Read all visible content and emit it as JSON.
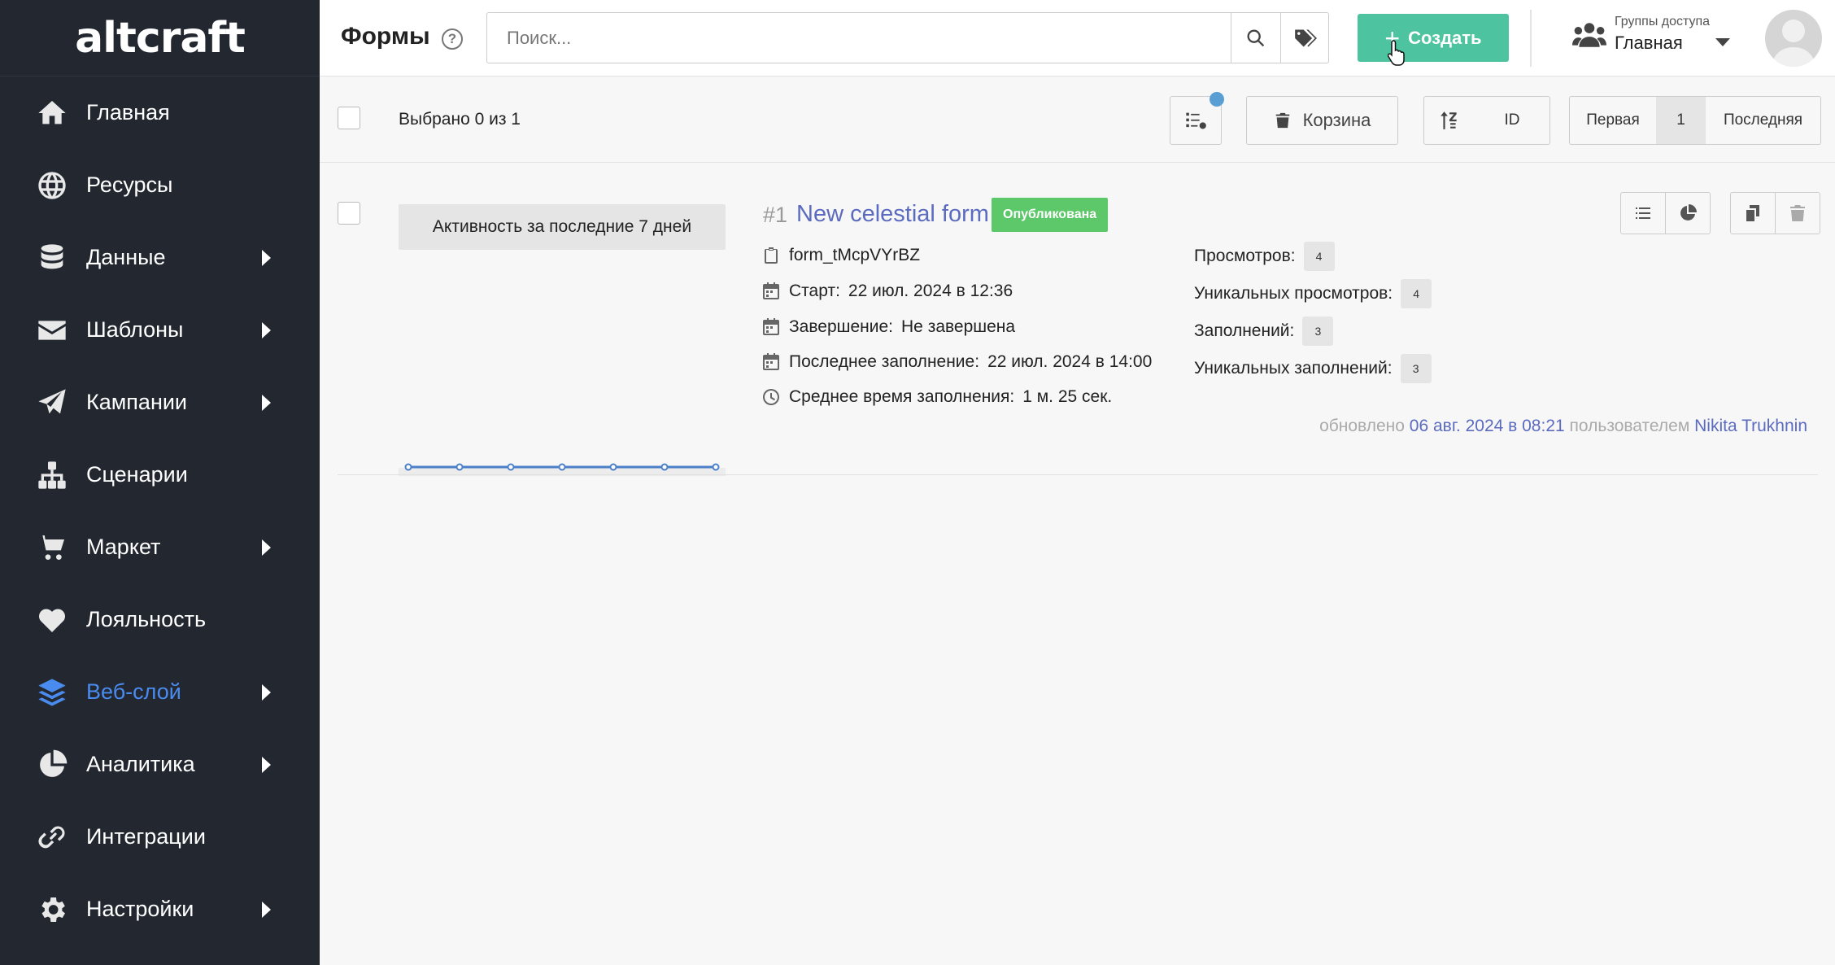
{
  "app": {
    "logo_text": "altcraft"
  },
  "sidebar": {
    "items": [
      {
        "label": "Главная",
        "icon": "home-icon",
        "has_submenu": false,
        "active": false
      },
      {
        "label": "Ресурсы",
        "icon": "globe-icon",
        "has_submenu": false,
        "active": false
      },
      {
        "label": "Данные",
        "icon": "database-icon",
        "has_submenu": true,
        "active": false
      },
      {
        "label": "Шаблоны",
        "icon": "envelope-icon",
        "has_submenu": true,
        "active": false
      },
      {
        "label": "Кампании",
        "icon": "paper-plane-icon",
        "has_submenu": true,
        "active": false
      },
      {
        "label": "Сценарии",
        "icon": "sitemap-icon",
        "has_submenu": false,
        "active": false
      },
      {
        "label": "Маркет",
        "icon": "cart-icon",
        "has_submenu": true,
        "active": false
      },
      {
        "label": "Лояльность",
        "icon": "heart-icon",
        "has_submenu": false,
        "active": false
      },
      {
        "label": "Веб-слой",
        "icon": "layers-icon",
        "has_submenu": true,
        "active": true
      },
      {
        "label": "Аналитика",
        "icon": "pie-chart-icon",
        "has_submenu": true,
        "active": false
      },
      {
        "label": "Интеграции",
        "icon": "link-icon",
        "has_submenu": false,
        "active": false
      },
      {
        "label": "Настройки",
        "icon": "gear-icon",
        "has_submenu": true,
        "active": false
      }
    ],
    "active_color": "#4a8bf0",
    "background": "#232830"
  },
  "header": {
    "title": "Формы",
    "help_symbol": "?",
    "search_placeholder": "Поиск...",
    "search_value": "",
    "create_label": "Создать",
    "create_color": "#4ec3a0",
    "access_groups_label": "Группы доступа",
    "access_groups_value": "Главная"
  },
  "toolbar": {
    "selected_text": "Выбрано 0 из 1",
    "trash_label": "Корзина",
    "sort_field": "ID",
    "pagination": {
      "first": "Первая",
      "current": "1",
      "last": "Последняя"
    }
  },
  "forms": [
    {
      "activity_label": "Активность за последние 7 дней",
      "id_label": "#1",
      "name": "New celestial form",
      "status": "Опубликована",
      "status_color": "#5cc86a",
      "code": "form_tMcpVYrBZ",
      "start_label": "Старт:",
      "start_value": "22 июл. 2024 в 12:36",
      "end_label": "Завершение:",
      "end_value": "Не завершена",
      "last_fill_label": "Последнее заполнение:",
      "last_fill_value": "22 июл. 2024 в 14:00",
      "avg_time_label": "Среднее время заполнения:",
      "avg_time_value": "1 м. 25 сек.",
      "stats": [
        {
          "label": "Просмотров:",
          "value": "4"
        },
        {
          "label": "Уникальных просмотров:",
          "value": "4"
        },
        {
          "label": "Заполнений:",
          "value": "3"
        },
        {
          "label": "Уникальных заполнений:",
          "value": "3"
        }
      ],
      "updated_prefix": "обновлено",
      "updated_date": "06 авг. 2024 в 08:21",
      "updated_by_prefix": "пользователем",
      "updated_by": "Nikita Trukhnin",
      "activity_points": [
        0,
        0,
        0,
        0,
        0,
        0,
        0
      ]
    }
  ]
}
